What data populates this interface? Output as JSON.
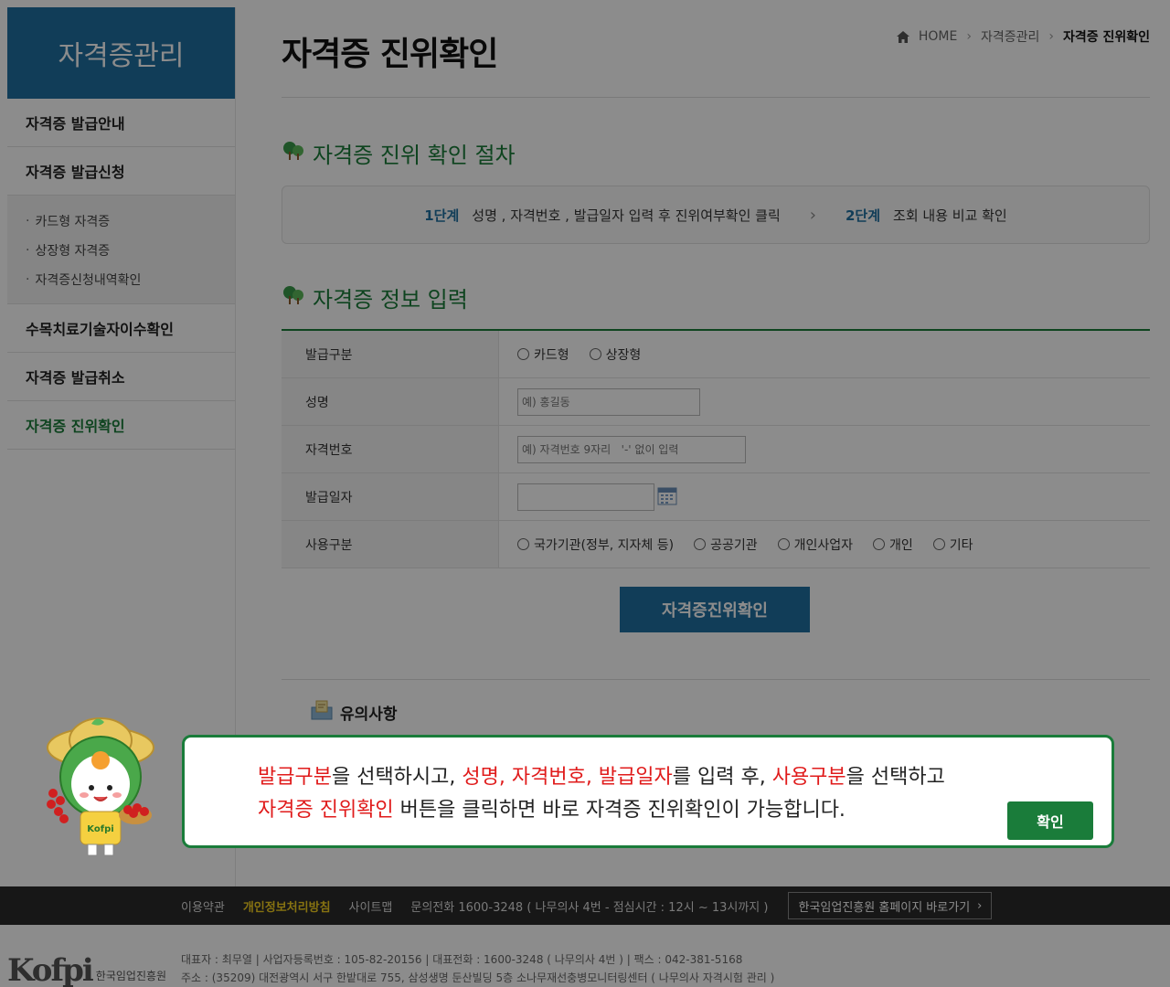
{
  "sidebar": {
    "title": "자격증관리",
    "items": [
      {
        "label": "자격증  발급안내"
      },
      {
        "label": "자격증  발급신청"
      }
    ],
    "sub_items": [
      {
        "label": "카드형 자격증"
      },
      {
        "label": "상장형 자격증"
      },
      {
        "label": "자격증신청내역확인"
      }
    ],
    "items_after": [
      {
        "label": "수목치료기술자이수확인"
      },
      {
        "label": "자격증  발급취소"
      },
      {
        "label": "자격증  진위확인"
      }
    ]
  },
  "header": {
    "title": "자격증 진위확인",
    "breadcrumb": {
      "home": "HOME",
      "level1": "자격증관리",
      "current": "자격증 진위확인"
    }
  },
  "procedure": {
    "title": "자격증 진위 확인 절차",
    "step1_label": "1단계",
    "step1_text": "성명 , 자격번호 , 발급일자 입력 후 진위여부확인 클릭",
    "step2_label": "2단계",
    "step2_text": "조회 내용 비교 확인"
  },
  "form": {
    "title": "자격증 정보 입력",
    "issue_type_label": "발급구분",
    "issue_type_options": [
      "카드형",
      "상장형"
    ],
    "name_label": "성명",
    "name_placeholder": "예) 홍길동",
    "cert_no_label": "자격번호",
    "cert_no_placeholder": "예) 자격번호 9자리   '-' 없이 입력",
    "issue_date_label": "발급일자",
    "issue_date_value": "",
    "usage_label": "사용구분",
    "usage_options": [
      "국가기관(정부, 지자체 등)",
      "공공기관",
      "개인사업자",
      "개인",
      "기타"
    ],
    "submit_label": "자격증진위확인"
  },
  "notice": {
    "title": "유의사항"
  },
  "popup": {
    "line1_red1": "발급구분",
    "line1_t1": "을 선택하시고, ",
    "line1_red2": "성명, 자격번호, 발급일자",
    "line1_t2": "를 입력 후, ",
    "line1_red3": "사용구분",
    "line1_t3": "을 선택하고",
    "line2_red": "자격증 진위확인",
    "line2_t": " 버튼을 클릭하면 바로 자격증 진위확인이 가능합니다.",
    "confirm_label": "확인",
    "mascot_badge": "Kofpi"
  },
  "footer": {
    "links": [
      "이용약관",
      "개인정보처리방침",
      "사이트맵"
    ],
    "phone": "문의전화 1600-3248 ( 나무의사 4번 - 점심시간 : 12시 ~ 13시까지 )",
    "homepage": "한국임업진흥원 홈페이지 바로가기",
    "logo_mark": "Kofpi",
    "logo_text": "한국임업진흥원",
    "info_line1": "대표자 : 최무열 | 사업자등록번호 : 105-82-20156 | 대표전화 : 1600-3248 ( 나무의사 4번 ) | 팩스 : 042-381-5168",
    "info_line2": "주소 : (35209) 대전광역시 서구 한밭대로 755, 삼성생명 둔산빌딩 5층 소나무재선충병모니터링센터 ( 나무의사 자격시험 관리 )"
  },
  "colors": {
    "brand_blue": "#1f6fa0",
    "brand_green": "#1a7c3a",
    "highlight_red": "#e01b1b"
  }
}
